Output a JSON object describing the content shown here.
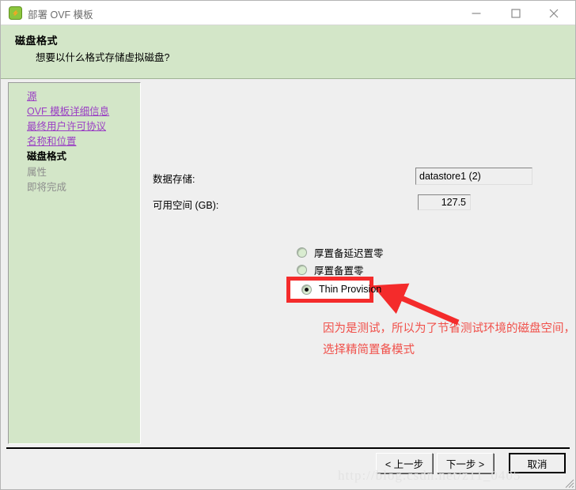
{
  "window": {
    "title": "部署 OVF 模板",
    "icon": "ovf-app-icon",
    "controls": {
      "minimize": "minimize-icon",
      "maximize": "maximize-icon",
      "close": "close-icon"
    }
  },
  "header": {
    "title": "磁盘格式",
    "subtitle": "想要以什么格式存储虚拟磁盘?"
  },
  "sidebar": {
    "items": [
      {
        "label": "源",
        "state": "link"
      },
      {
        "label": "OVF 模板详细信息",
        "state": "link"
      },
      {
        "label": "最终用户许可协议",
        "state": "link"
      },
      {
        "label": "名称和位置",
        "state": "link"
      },
      {
        "label": "磁盘格式",
        "state": "current"
      },
      {
        "label": "属性",
        "state": "future"
      },
      {
        "label": "即将完成",
        "state": "future"
      }
    ]
  },
  "main": {
    "fields": [
      {
        "label": "数据存储:",
        "value": "datastore1 (2)"
      },
      {
        "label": "可用空间 (GB):",
        "value": "127.5"
      }
    ],
    "disk_format_options": [
      {
        "label": "厚置备延迟置零",
        "selected": false
      },
      {
        "label": "厚置备置零",
        "selected": false
      },
      {
        "label": "Thin Provision",
        "selected": true
      }
    ]
  },
  "annotation": {
    "line1": "因为是测试，所以为了节省测试环境的磁盘空间，在这里",
    "line2": "选择精简置备模式",
    "color": "#f0504a",
    "highlight_color": "#f42b2b"
  },
  "footer": {
    "buttons": [
      {
        "label": "< 上一步",
        "focused": false
      },
      {
        "label": "下一步 >",
        "focused": false
      },
      {
        "label": "取消",
        "focused": true
      }
    ]
  },
  "watermark": {
    "text": "http://blog.csdn.net/z11_0405"
  }
}
